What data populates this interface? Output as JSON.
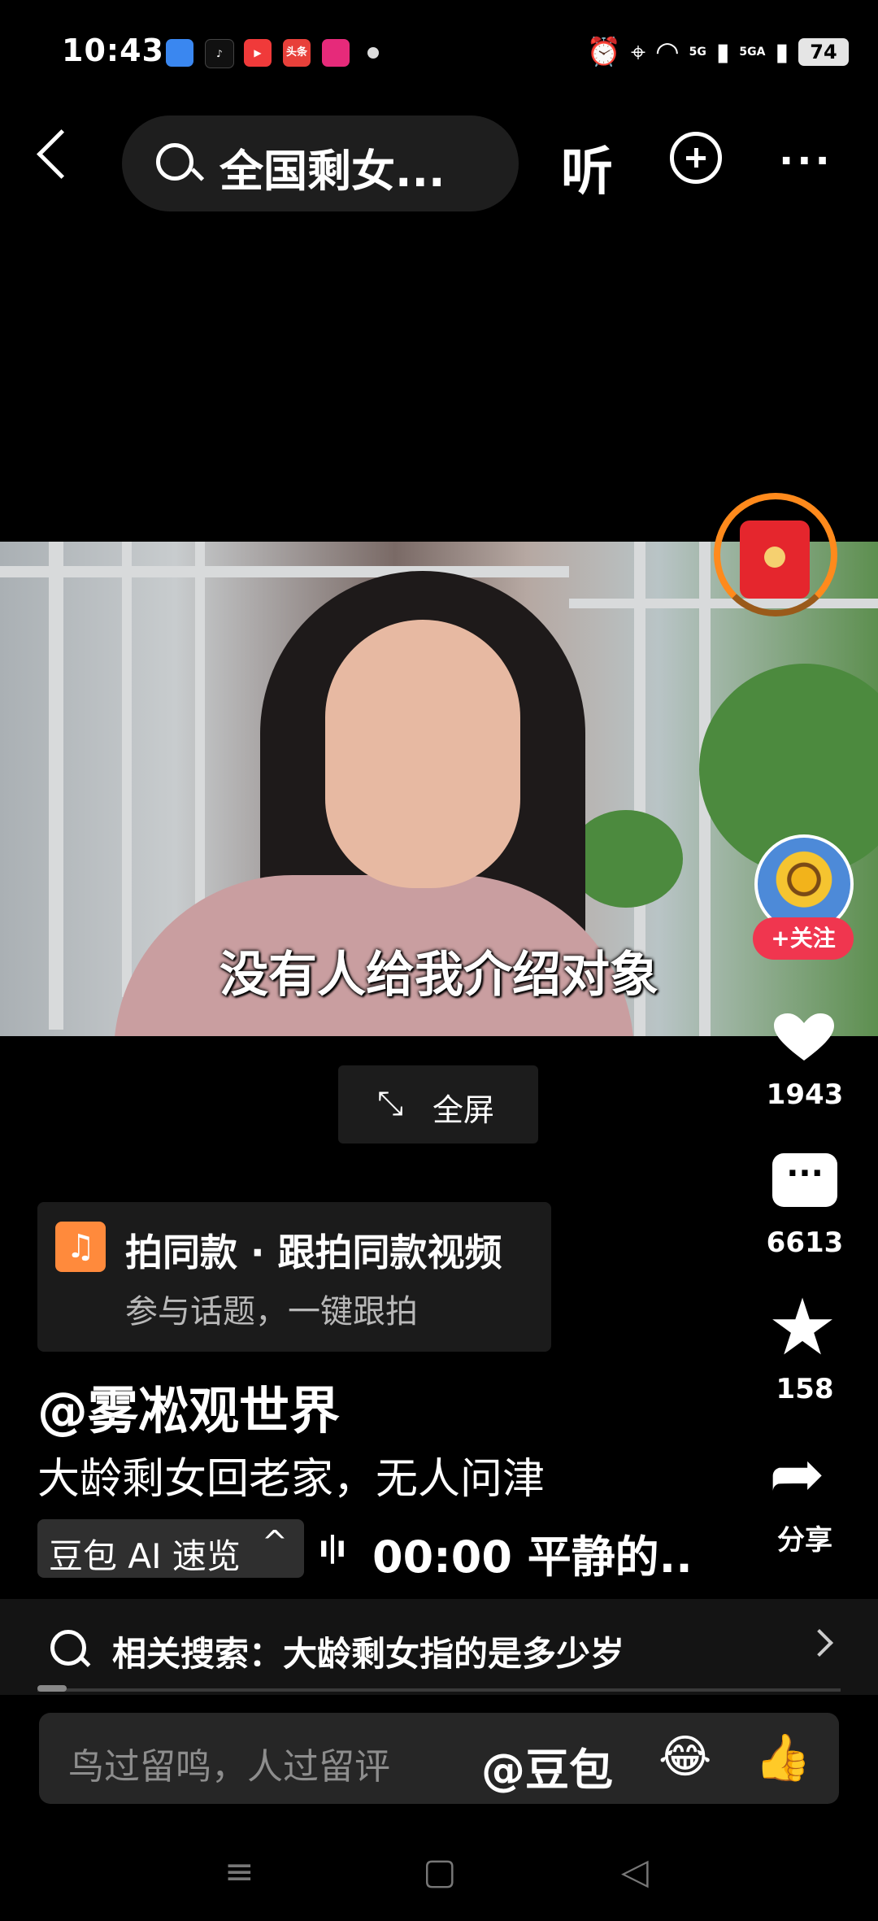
{
  "status_bar": {
    "time": "10:43",
    "app_icons": [
      "blue-app-icon",
      "tiktok-icon",
      "video-app-icon",
      "toutiao-icon",
      "vip-app-icon"
    ],
    "toutiao_label": "头条",
    "signal1": "5G",
    "signal2": "5GA",
    "battery": "74"
  },
  "header": {
    "search_text": "全国剩女...",
    "listen_label": "听",
    "more_label": "···"
  },
  "video": {
    "subtitle": "没有人给我介绍对象",
    "fullscreen_icon": "⤡",
    "fullscreen_label": "全屏"
  },
  "side_rail": {
    "follow_label": "+关注",
    "likes": "1943",
    "comments": "6613",
    "favorites": "158",
    "share_label": "分享",
    "comment_dots": "···"
  },
  "same_style": {
    "icon": "♫",
    "title": "拍同款 · 跟拍同款视频",
    "subtitle": "参与话题，一键跟拍"
  },
  "post": {
    "author": "@雾凇观世界",
    "description": "大龄剩女回老家，无人问津",
    "ai_label": "豆包 AI 速览",
    "ai_chevron": "^",
    "ai_wave": "ı|ı",
    "ai_text": "00:00 平静的.."
  },
  "related_search": {
    "text": "相关搜索：大龄剩女指的是多少岁"
  },
  "comment_input": {
    "placeholder": "鸟过留鸣，人过留评",
    "mention": "@豆包",
    "emoji1": "😂",
    "emoji2": "👍"
  },
  "nav_bar": {
    "menu": "≡",
    "home": "▢",
    "back": "◁"
  },
  "colors": {
    "follow_red": "#f0364f",
    "packet_ring": "#ff8a1c",
    "music_orange": "#ff8a3c"
  }
}
